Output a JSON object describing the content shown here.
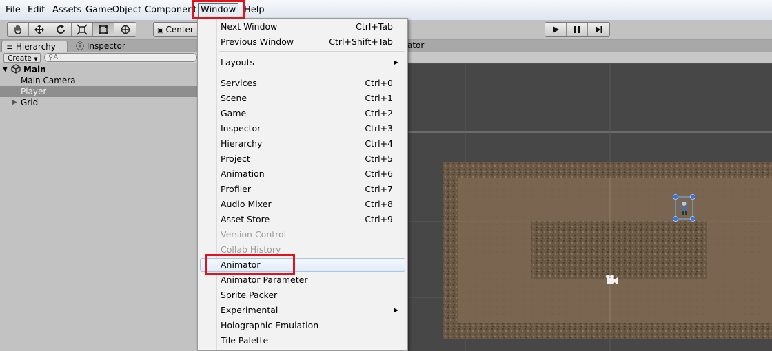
{
  "menubar": {
    "items": [
      "File",
      "Edit",
      "Assets",
      "GameObject",
      "Component",
      "Window",
      "Help"
    ]
  },
  "toolbar": {
    "transform_tools": [
      "hand-icon",
      "move-icon",
      "rotate-icon",
      "scale-icon",
      "rect-icon",
      "transform-icon"
    ],
    "pivot_label": "Center",
    "play_controls": [
      "play-icon",
      "pause-icon",
      "step-icon"
    ]
  },
  "hierarchy": {
    "tab_label": "Hierarchy",
    "inspector_tab_label": "Inspector",
    "create_label": "Create",
    "search_placeholder": "All",
    "scene_name": "Main",
    "items": [
      {
        "label": "Main Camera",
        "selected": false
      },
      {
        "label": "Player",
        "selected": true
      },
      {
        "label": "Grid",
        "selected": false
      }
    ]
  },
  "scene_view": {
    "tab_label_fragment": "ator"
  },
  "window_menu": {
    "items": [
      {
        "label": "Next Window",
        "shortcut": "Ctrl+Tab"
      },
      {
        "label": "Previous Window",
        "shortcut": "Ctrl+Shift+Tab"
      },
      {
        "label": "Layouts",
        "submenu": true
      },
      {
        "label": "Services",
        "shortcut": "Ctrl+0"
      },
      {
        "label": "Scene",
        "shortcut": "Ctrl+1"
      },
      {
        "label": "Game",
        "shortcut": "Ctrl+2"
      },
      {
        "label": "Inspector",
        "shortcut": "Ctrl+3"
      },
      {
        "label": "Hierarchy",
        "shortcut": "Ctrl+4"
      },
      {
        "label": "Project",
        "shortcut": "Ctrl+5"
      },
      {
        "label": "Animation",
        "shortcut": "Ctrl+6"
      },
      {
        "label": "Profiler",
        "shortcut": "Ctrl+7"
      },
      {
        "label": "Audio Mixer",
        "shortcut": "Ctrl+8"
      },
      {
        "label": "Asset Store",
        "shortcut": "Ctrl+9"
      },
      {
        "label": "Version Control",
        "disabled": true
      },
      {
        "label": "Collab History",
        "disabled": true
      },
      {
        "label": "Animator",
        "highlighted": true
      },
      {
        "label": "Animator Parameter"
      },
      {
        "label": "Sprite Packer"
      },
      {
        "label": "Experimental",
        "submenu": true
      },
      {
        "label": "Holographic Emulation"
      },
      {
        "label": "Tile Palette"
      }
    ]
  },
  "colors": {
    "highlight_box": "#e0141c",
    "selection": "#8e8e8e",
    "menu_hover": "#e2ecf8"
  }
}
